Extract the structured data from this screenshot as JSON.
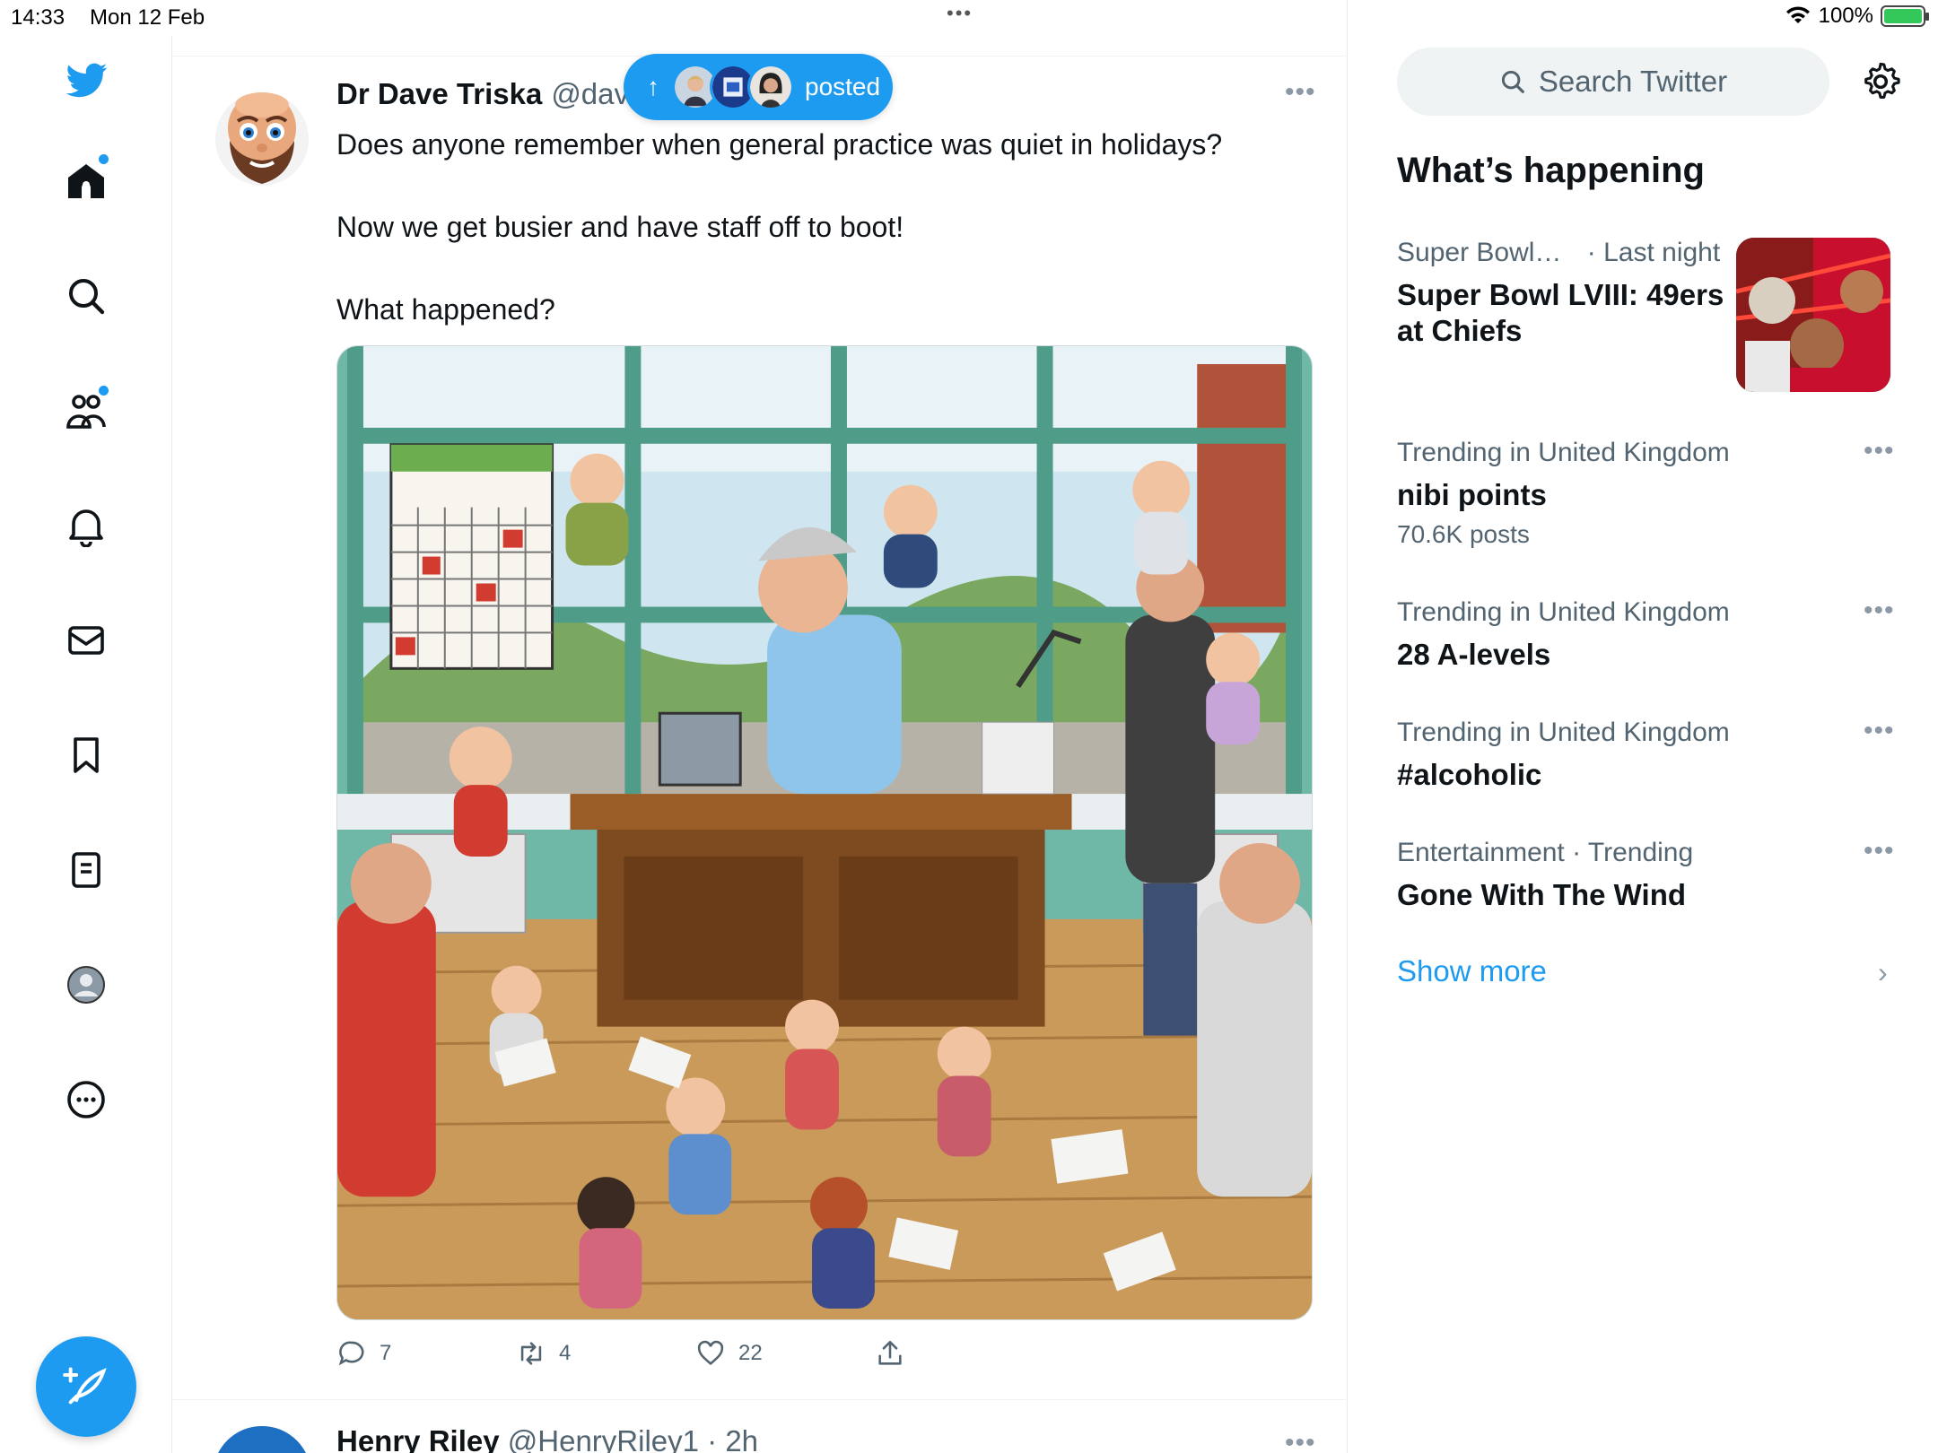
{
  "status_bar": {
    "time": "14:33",
    "date": "Mon 12 Feb",
    "battery": "100%",
    "multitask_dots": "•••"
  },
  "nav": {
    "items": [
      "home",
      "search",
      "communities",
      "notifications",
      "messages",
      "bookmarks",
      "lists",
      "profile",
      "more"
    ],
    "accent_color": "#1d9bf0"
  },
  "new_posts_pill": {
    "label": "posted",
    "arrow": "↑"
  },
  "tweet": {
    "author_name": "Dr Dave Triska",
    "author_handle": "@dav",
    "paragraphs": [
      "Does anyone remember when general practice was quiet in holidays?",
      "Now we get busier and have staff off to boot!",
      "What happened?"
    ],
    "replies": "7",
    "retweets": "4",
    "likes": "22"
  },
  "next_tweet": {
    "author_name": "Henry Riley",
    "author_handle": "@HenryRiley1 · 2h"
  },
  "sidebar": {
    "search_placeholder": "Search Twitter",
    "section_title": "What’s happening",
    "trends": [
      {
        "category": "Super Bowl…",
        "time": "· Last night",
        "title": "Super Bowl LVIII: 49ers at Chiefs",
        "count": ""
      },
      {
        "category": "Trending in United Kingdom",
        "time": "",
        "title": "nibi points",
        "count": "70.6K posts"
      },
      {
        "category": "Trending in United Kingdom",
        "time": "",
        "title": "28 A-levels",
        "count": ""
      },
      {
        "category": "Trending in United Kingdom",
        "time": "",
        "title": "#alcoholic",
        "count": ""
      },
      {
        "category": "Entertainment · Trending",
        "time": "",
        "title": "Gone With The Wind",
        "count": ""
      }
    ],
    "show_more": "Show more"
  }
}
